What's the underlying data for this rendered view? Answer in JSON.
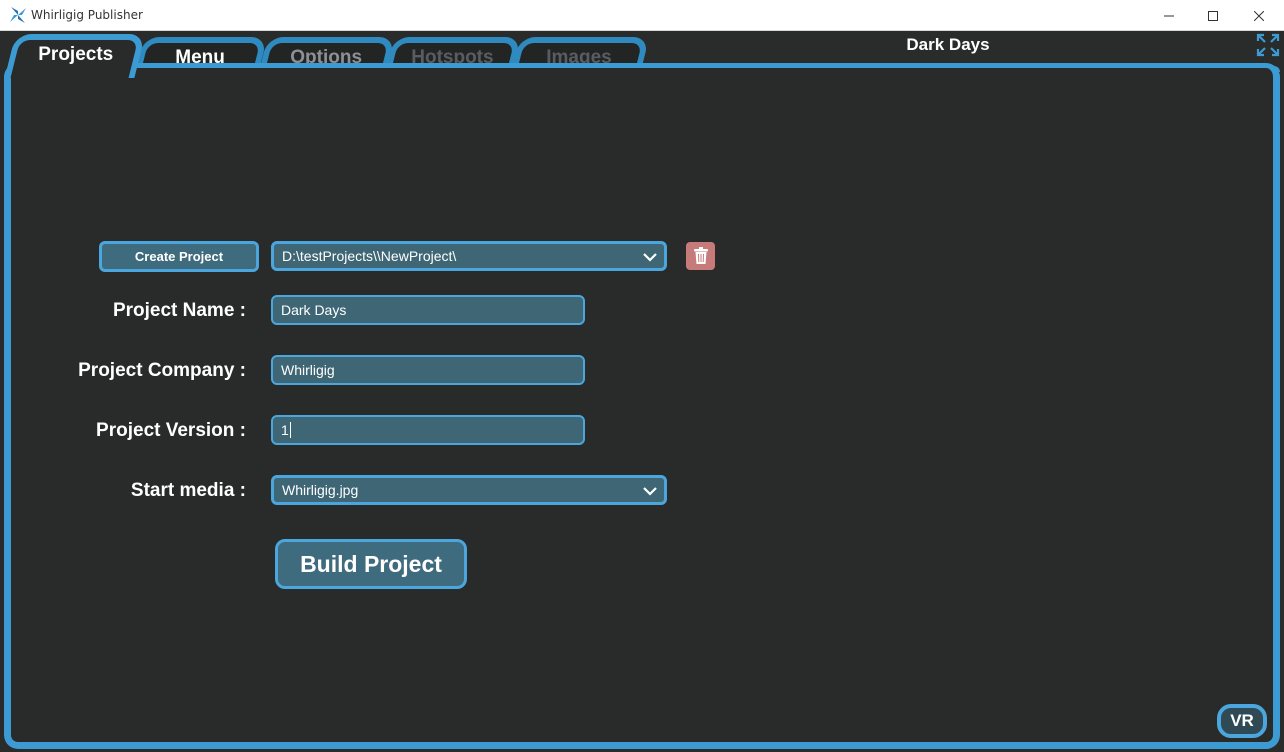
{
  "window": {
    "title": "Whirligig Publisher",
    "minimize_icon": "minimize-icon",
    "maximize_icon": "maximize-icon",
    "close_icon": "close-icon"
  },
  "header": {
    "project_title": "Dark Days",
    "expand_icon": "fullscreen-expand-icon"
  },
  "tabs": [
    {
      "label": "Projects",
      "active": true
    },
    {
      "label": "Menu",
      "active": false
    },
    {
      "label": "Options",
      "active": false
    },
    {
      "label": "Hotspots",
      "active": false
    },
    {
      "label": "Images",
      "active": false
    }
  ],
  "project_form": {
    "create_button": "Create Project",
    "project_path": "D:\\testProjects\\\\NewProject\\",
    "delete_icon": "trash-icon",
    "name_label": "Project Name :",
    "name_value": "Dark Days",
    "company_label": "Project Company :",
    "company_value": "Whirligig",
    "version_label": "Project Version :",
    "version_value": "1",
    "start_media_label": "Start media :",
    "start_media_value": "Whirligig.jpg",
    "build_button": "Build Project"
  },
  "footer": {
    "vr_button": "VR"
  },
  "colors": {
    "accent": "#3b9bd2",
    "background": "#292a2a",
    "field": "#3f6675",
    "delete": "#c77a7a"
  }
}
